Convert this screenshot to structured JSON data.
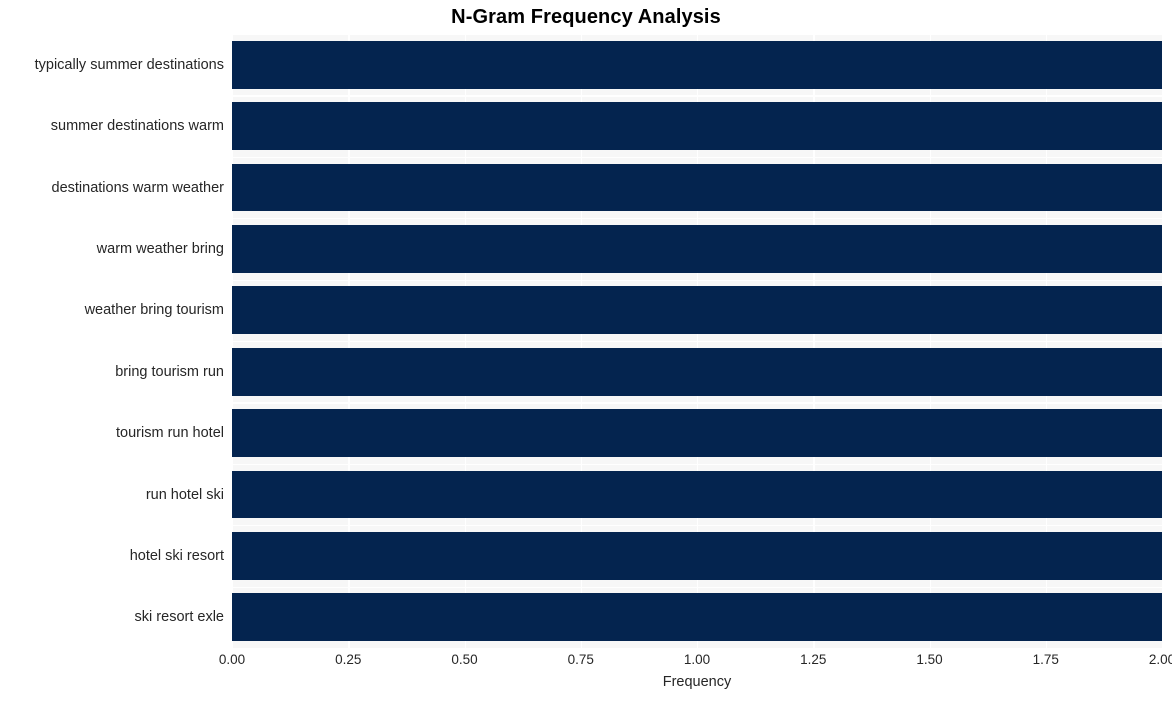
{
  "chart_data": {
    "type": "bar",
    "orientation": "horizontal",
    "title": "N-Gram Frequency Analysis",
    "xlabel": "Frequency",
    "ylabel": "",
    "categories": [
      "typically summer destinations",
      "summer destinations warm",
      "destinations warm weather",
      "warm weather bring",
      "weather bring tourism",
      "bring tourism run",
      "tourism run hotel",
      "run hotel ski",
      "hotel ski resort",
      "ski resort exle"
    ],
    "values": [
      2,
      2,
      2,
      2,
      2,
      2,
      2,
      2,
      2,
      2
    ],
    "xlim": [
      0,
      2
    ],
    "xticks": [
      "0.00",
      "0.25",
      "0.50",
      "0.75",
      "1.00",
      "1.25",
      "1.50",
      "1.75",
      "2.00"
    ],
    "xtick_values": [
      0,
      0.25,
      0.5,
      0.75,
      1.0,
      1.25,
      1.5,
      1.75,
      2.0
    ],
    "grid": true,
    "legend": null,
    "bar_color": "#04244f",
    "plot_background": "#f7f7f7",
    "grid_color": "#ffffff",
    "figure_background": "#ffffff",
    "text_color": "#262626"
  }
}
